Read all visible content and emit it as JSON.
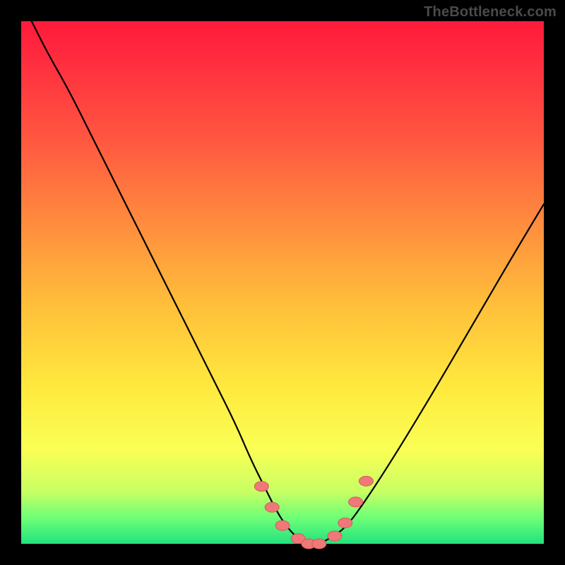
{
  "watermark": "TheBottleneck.com",
  "colors": {
    "frame": "#000000",
    "curve_stroke": "#000000",
    "marker_fill": "#f07878",
    "marker_stroke": "#d25c5c",
    "gradient_stops": [
      "#ff1a3a",
      "#ff2e3f",
      "#ff5540",
      "#ff8a3e",
      "#ffc13a",
      "#ffe93e",
      "#faff55",
      "#c8ff63",
      "#6eff77",
      "#22e27e"
    ]
  },
  "chart_data": {
    "type": "line",
    "title": "",
    "xlabel": "",
    "ylabel": "",
    "xlim": [
      0,
      100
    ],
    "ylim": [
      0,
      100
    ],
    "series": [
      {
        "name": "curve",
        "x": [
          2,
          5,
          9,
          13,
          17,
          21,
          25,
          29,
          33,
          37,
          41,
          44,
          47,
          49,
          51,
          53,
          55,
          57,
          59,
          62,
          65,
          69,
          74,
          80,
          87,
          94,
          100
        ],
        "y": [
          100,
          94,
          87,
          79,
          71,
          63,
          55,
          47,
          39,
          31,
          23,
          16,
          10,
          6,
          3,
          1,
          0,
          0,
          1,
          3,
          7,
          13,
          21,
          31,
          43,
          55,
          65
        ]
      }
    ],
    "markers": {
      "name": "highlighted-points",
      "points": [
        {
          "x": 46,
          "y": 11
        },
        {
          "x": 48,
          "y": 7
        },
        {
          "x": 50,
          "y": 3.5
        },
        {
          "x": 53,
          "y": 1
        },
        {
          "x": 55,
          "y": 0
        },
        {
          "x": 57,
          "y": 0
        },
        {
          "x": 60,
          "y": 1.5
        },
        {
          "x": 62,
          "y": 4
        },
        {
          "x": 64,
          "y": 8
        },
        {
          "x": 66,
          "y": 12
        }
      ]
    },
    "highlight_band": {
      "x_start": 50,
      "x_end": 66,
      "y_floor": 0
    }
  }
}
